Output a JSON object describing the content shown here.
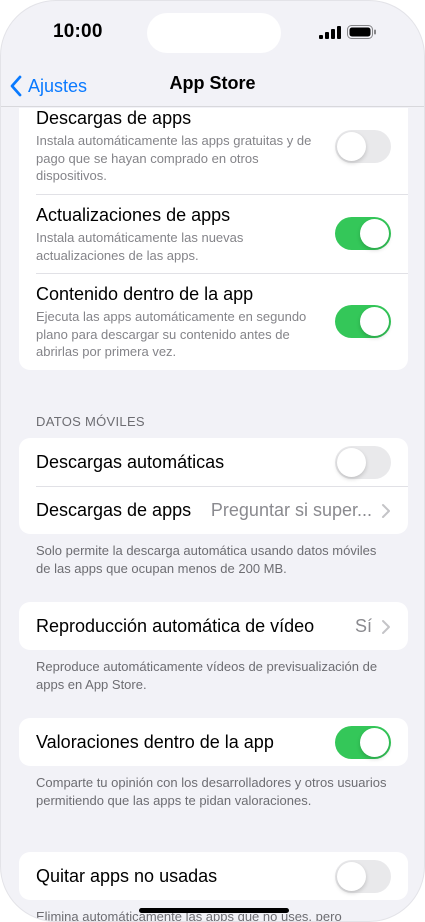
{
  "status_bar": {
    "time": "10:00"
  },
  "nav": {
    "back_label": "Ajustes",
    "title": "App Store"
  },
  "section1": {
    "rows": [
      {
        "title": "Descargas de apps",
        "subtitle": "Instala automáticamente las apps gratuitas y de pago que se hayan comprado en otros dispositivos.",
        "toggle_on": false
      },
      {
        "title": "Actualizaciones de apps",
        "subtitle": "Instala automáticamente las nuevas actualizaciones de las apps.",
        "toggle_on": true
      },
      {
        "title": "Contenido dentro de la app",
        "subtitle": "Ejecuta las apps automáticamente en segundo plano para descargar su contenido antes de abrirlas por primera vez.",
        "toggle_on": true
      }
    ]
  },
  "mobile_data": {
    "header": "DATOS MÓVILES",
    "auto_downloads": {
      "title": "Descargas automáticas",
      "toggle_on": false
    },
    "app_downloads": {
      "title": "Descargas de apps",
      "value": "Preguntar si super..."
    },
    "footer": "Solo permite la descarga automática usando datos móviles de las apps que ocupan menos de 200 MB."
  },
  "video": {
    "title": "Reproducción automática de vídeo",
    "value": "Sí",
    "footer": "Reproduce automáticamente vídeos de previsualización de apps en App Store."
  },
  "ratings": {
    "title": "Valoraciones dentro de la app",
    "toggle_on": true,
    "footer": "Comparte tu opinión con los desarrolladores y otros usuarios permitiendo que las apps te pidan valoraciones."
  },
  "offload": {
    "title": "Quitar apps no usadas",
    "toggle_on": false,
    "footer": "Elimina automáticamente las apps que no uses, pero"
  },
  "colors": {
    "accent": "#0a7aff",
    "toggle_on": "#34c759",
    "toggle_off": "#e9e9eb",
    "background": "#f2f2f7"
  }
}
